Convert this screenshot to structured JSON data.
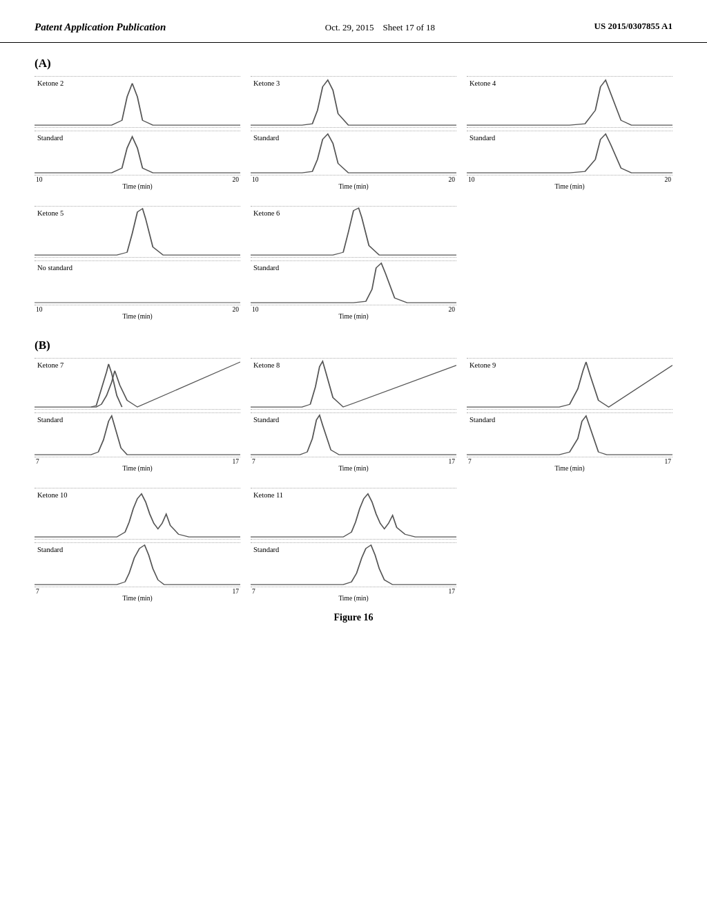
{
  "header": {
    "left_label": "Patent Application Publication",
    "center_date": "Oct. 29, 2015",
    "center_sheet": "Sheet 17 of 18",
    "right_patent": "US 2015/0307855 A1"
  },
  "sectionA": {
    "label": "(A)",
    "row1": {
      "panels": [
        {
          "id": "k2",
          "top_label": "Ketone 2",
          "bottom_label": "Standard"
        },
        {
          "id": "k3",
          "top_label": "Ketone 3",
          "bottom_label": "Standard"
        },
        {
          "id": "k4",
          "top_label": "Ketone 4",
          "bottom_label": "Standard"
        }
      ],
      "x_axis": {
        "start": "10",
        "mid": "20",
        "title": "Time (min)"
      }
    },
    "row2": {
      "panels": [
        {
          "id": "k5",
          "top_label": "Ketone 5",
          "bottom_label": "No standard"
        },
        {
          "id": "k6",
          "top_label": "Ketone 6",
          "bottom_label": "Standard"
        }
      ],
      "x_axis": {
        "start": "10",
        "mid": "20",
        "title": "Time (min)"
      }
    }
  },
  "sectionB": {
    "label": "(B)",
    "row1": {
      "panels": [
        {
          "id": "k7",
          "top_label": "Ketone 7",
          "bottom_label": "Standard"
        },
        {
          "id": "k8",
          "top_label": "Ketone 8",
          "bottom_label": "Standard"
        },
        {
          "id": "k9",
          "top_label": "Ketone 9",
          "bottom_label": "Standard"
        }
      ],
      "x_axis": {
        "start": "7",
        "mid": "17",
        "title": "Time (min)"
      }
    },
    "row2": {
      "panels": [
        {
          "id": "k10",
          "top_label": "Ketone 10",
          "bottom_label": "Standard"
        },
        {
          "id": "k11",
          "top_label": "Ketone 11",
          "bottom_label": "Standard"
        }
      ],
      "x_axis": {
        "start": "7",
        "mid": "17",
        "title": "Time (min)"
      }
    }
  },
  "figure_caption": "Figure 16"
}
